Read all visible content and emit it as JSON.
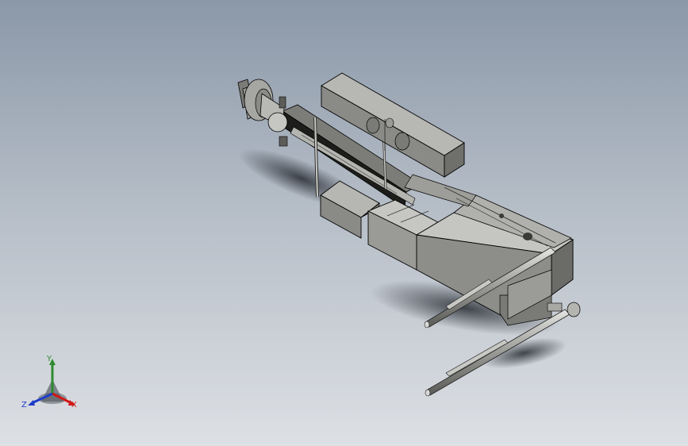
{
  "viewport": {
    "background_top": "#8b98a8",
    "background_bottom": "#dde0e4",
    "model_color": "#8e8e8a",
    "shadow_color": "#3a3f46"
  },
  "triad": {
    "x_label": "X",
    "y_label": "Y",
    "z_label": "Z",
    "x_color": "#d01818",
    "y_color": "#2e8b2e",
    "z_color": "#1f3cc8"
  }
}
